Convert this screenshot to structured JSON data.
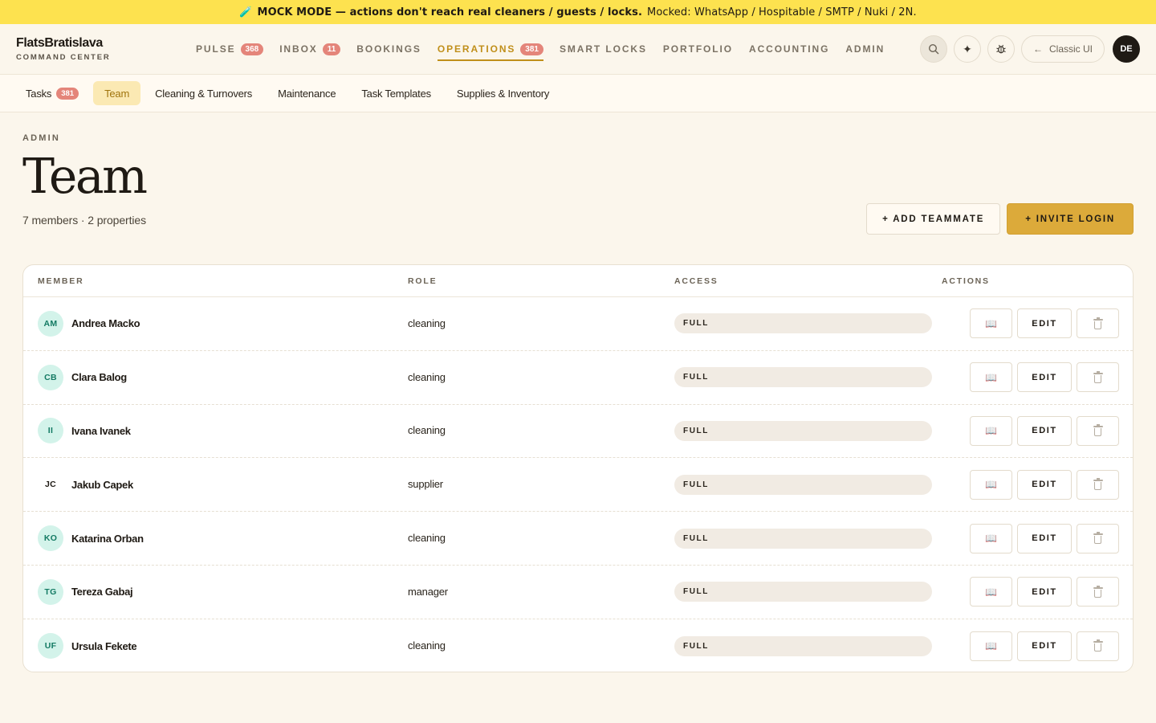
{
  "banner": {
    "icon": "test-tube-icon",
    "strong_text": "MOCK MODE — actions don't reach real cleaners / guests / locks.",
    "detail_text": "Mocked: WhatsApp / Hospitable / SMTP / Nuki / 2N."
  },
  "brand": {
    "name": "FlatsBratislava",
    "subtitle": "COMMAND CENTER"
  },
  "nav": {
    "items": [
      {
        "label": "PULSE",
        "badge": "368"
      },
      {
        "label": "INBOX",
        "badge": "11"
      },
      {
        "label": "BOOKINGS",
        "badge": ""
      },
      {
        "label": "OPERATIONS",
        "badge": "381",
        "active": true
      },
      {
        "label": "SMART LOCKS",
        "badge": ""
      },
      {
        "label": "PORTFOLIO",
        "badge": ""
      },
      {
        "label": "ACCOUNTING",
        "badge": ""
      },
      {
        "label": "ADMIN",
        "badge": ""
      }
    ],
    "classic_label": "Classic UI",
    "user_initials": "DE"
  },
  "subtabs": [
    {
      "label": "Tasks",
      "badge": "381"
    },
    {
      "label": "Team",
      "active": true
    },
    {
      "label": "Cleaning & Turnovers"
    },
    {
      "label": "Maintenance"
    },
    {
      "label": "Task Templates"
    },
    {
      "label": "Supplies & Inventory"
    }
  ],
  "page": {
    "eyebrow": "ADMIN",
    "title": "Team",
    "subtitle": "7 members · 2 properties",
    "add_teammate_label": "+ ADD TEAMMATE",
    "invite_login_label": "+ INVITE LOGIN"
  },
  "table": {
    "headers": {
      "member": "MEMBER",
      "role": "ROLE",
      "access": "ACCESS",
      "actions": "ACTIONS"
    },
    "edit_label": "EDIT",
    "rows": [
      {
        "initials": "AM",
        "name": "Andrea Macko",
        "role": "cleaning",
        "access": "FULL",
        "avatar_style": "teal"
      },
      {
        "initials": "CB",
        "name": "Clara Balog",
        "role": "cleaning",
        "access": "FULL",
        "avatar_style": "teal"
      },
      {
        "initials": "II",
        "name": "Ivana Ivanek",
        "role": "cleaning",
        "access": "FULL",
        "avatar_style": "teal"
      },
      {
        "initials": "JC",
        "name": "Jakub Capek",
        "role": "supplier",
        "access": "FULL",
        "avatar_style": "plain"
      },
      {
        "initials": "KO",
        "name": "Katarina Orban",
        "role": "cleaning",
        "access": "FULL",
        "avatar_style": "teal"
      },
      {
        "initials": "TG",
        "name": "Tereza Gabaj",
        "role": "manager",
        "access": "FULL",
        "avatar_style": "teal"
      },
      {
        "initials": "UF",
        "name": "Ursula Fekete",
        "role": "cleaning",
        "access": "FULL",
        "avatar_style": "teal"
      }
    ]
  },
  "colors": {
    "banner": "#fde24f",
    "accent": "#c08f1a",
    "primary_button": "#dcaa3a",
    "badge": "#e4857a",
    "avatar_bg": "#d3f3ea",
    "avatar_text": "#137a63"
  }
}
